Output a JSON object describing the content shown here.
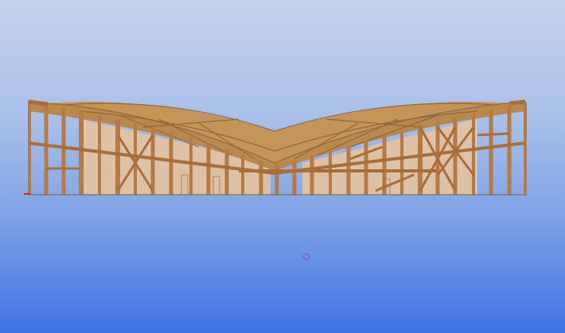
{
  "scene": {
    "model": "timber-frame-structure",
    "view": "3d-perspective",
    "colors": {
      "sky_top": "#c3d3ec",
      "sky_bottom": "#3f73e4",
      "timber": "#b77a44",
      "timber_dark": "#8a5a2e",
      "roof": "#b8894f",
      "interior": "#e6c3a0",
      "origin_marker": "#e02020",
      "cursor_marker": "#b000c8"
    },
    "icons": {
      "cursor": "target-circle-icon",
      "origin": "origin-axis-icon"
    }
  }
}
